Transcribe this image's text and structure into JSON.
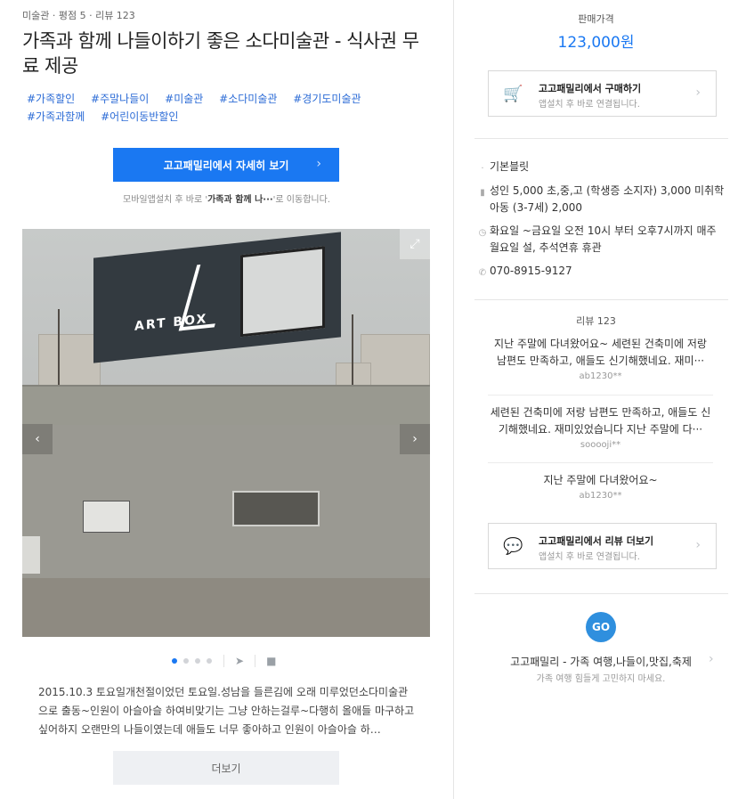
{
  "header": {
    "meta": "미술관 · 평점 5 · 리뷰 123",
    "title": "가족과 함께 나들이하기 좋은 소다미술관 - 식사권 무료 제공",
    "tags": [
      "#가족할인",
      "#주말나들이",
      "#미술관",
      "#소다미술관",
      "#경기도미술관",
      "#가족과함께",
      "#어린이동반할인"
    ]
  },
  "cta": {
    "label": "고고패밀리에서 자세히 보기",
    "note_prefix": "모바일앱설치 후 바로 '",
    "note_bold": "가족과 함께 나···",
    "note_suffix": "'로 이동합니다."
  },
  "gallery": {
    "photo_sign": "ART BOX",
    "dots_total": 4,
    "active_dot": 1
  },
  "description": {
    "text": "2015.10.3 토요일개천절이었던 토요일.성남을 들른김에 오래 미루었던소다미술관으로 출동~인원이 아슬아슬 하여비맞기는 그냥 안하는걸루~다행히 올애들 마구하고싶어하지 오랜만의 나들이였는데 애들도 너무 좋아하고 인원이 아슬아슬 하…",
    "more_label": "더보기"
  },
  "sidebar": {
    "price_label": "판매가격",
    "price": "123,000원",
    "buy_box": {
      "title": "고고패밀리에서 구매하기",
      "subtitle": "앱설치 후 바로 연결됩니다."
    },
    "info": [
      {
        "icon": "dot-icon",
        "text": "기본블릿"
      },
      {
        "icon": "person-icon",
        "text": "성인 5,000 초,중,고 (학생증 소지자) 3,000 미취학아동 (3-7세) 2,000"
      },
      {
        "icon": "clock-icon",
        "text": "화요일 ~금요일 오전 10시 부터 오후7시까지 매주 월요일 설, 추석연휴 휴관"
      },
      {
        "icon": "phone-icon",
        "text": "070-8915-9127"
      }
    ],
    "reviews_label": "리뷰 123",
    "reviews": [
      {
        "text": "지난 주말에 다녀왔어요~ 세련된 건축미에 저랑 남편도 만족하고, 애들도 신기해했네요. 재미···",
        "user": "ab1230**"
      },
      {
        "text": "세련된 건축미에 저랑 남편도 만족하고, 애들도 신기해했네요. 재미있었습니다 지난 주말에 다···",
        "user": "sooooji**"
      },
      {
        "text": "지난 주말에 다녀왔어요~",
        "user": "ab1230**"
      }
    ],
    "review_box": {
      "title": "고고패밀리에서 리뷰 더보기",
      "subtitle": "앱설치 후 바로 연결됩니다."
    },
    "app": {
      "logo": "GO",
      "title": "고고패밀리 - 가족 여행,나들이,맛집,축제",
      "subtitle": "가족 여행 힘들게 고민하지 마세요."
    }
  }
}
